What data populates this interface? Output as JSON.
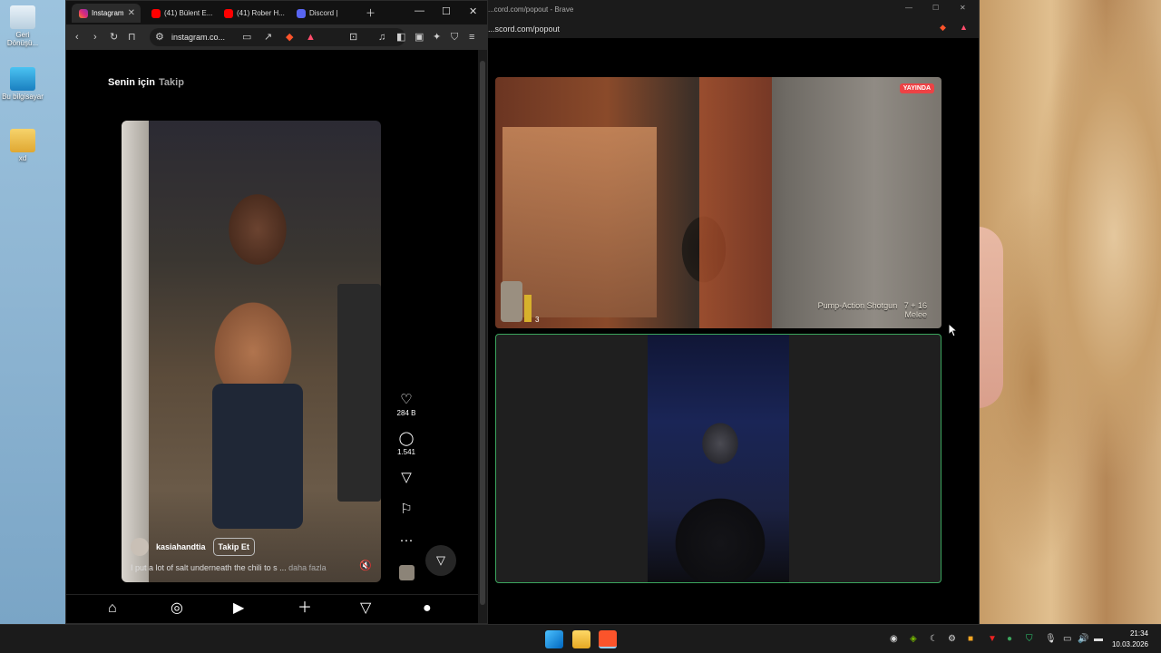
{
  "desktop": {
    "icons": [
      {
        "label": "Geri Dönüşü..."
      },
      {
        "label": "Bu bilgisayar"
      },
      {
        "label": "xd"
      }
    ]
  },
  "browser1": {
    "tabs": [
      {
        "label": "Instagram",
        "active": true
      },
      {
        "label": "(41) Bülent E..."
      },
      {
        "label": "(41) Rober H..."
      },
      {
        "label": "Discord |"
      }
    ],
    "url": "instagram.co...",
    "instagram": {
      "feed_tabs": [
        "Senin için",
        "Takip"
      ],
      "post": {
        "username": "kasiahandtia",
        "follow_label": "Takip Et",
        "caption": "I put a lot of salt underneath the chili to s ...",
        "more_label": "daha fazla",
        "likes": "284 B",
        "comments": "1.541"
      }
    }
  },
  "browser2": {
    "title": "...cord.com/popout - Brave",
    "url": "...scord.com/popout",
    "stream": {
      "live_label": "YAYINDA",
      "weapon": "Pump-Action Shotgun",
      "ammo": "7 + 16",
      "melee": "Melee",
      "counter": "3"
    }
  },
  "taskbar": {
    "time": "21:34",
    "date": "10.03.2026"
  },
  "colors": {
    "live": "#ed4245",
    "speaking": "#3ba55d",
    "instagram_bg": "#000000"
  }
}
